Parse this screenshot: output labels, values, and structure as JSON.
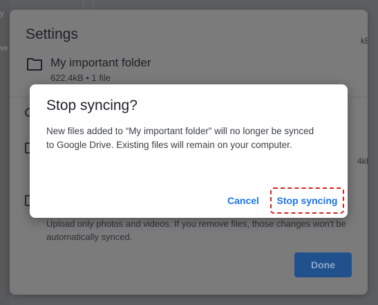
{
  "background": {
    "fragments": [
      "y",
      "ve"
    ],
    "size_fragments": [
      "kB",
      "4kB"
    ]
  },
  "settings": {
    "title": "Settings",
    "folder": {
      "name": "My important folder",
      "meta": "622.4kB • 1 file"
    },
    "description": "Upload only photos and videos. If you remove files, those changes won't be automatically synced.",
    "done_label": "Done"
  },
  "modal": {
    "title": "Stop syncing?",
    "message": "New files added to “My important folder” will no longer be synced to Google Drive. Existing files will remain on your computer.",
    "cancel_label": "Cancel",
    "confirm_label": "Stop syncing"
  },
  "colors": {
    "accent": "#1a73e8",
    "highlight_outline": "#d92020",
    "overlay": "#5f6062"
  },
  "icons": {
    "folder": "folder-icon"
  }
}
